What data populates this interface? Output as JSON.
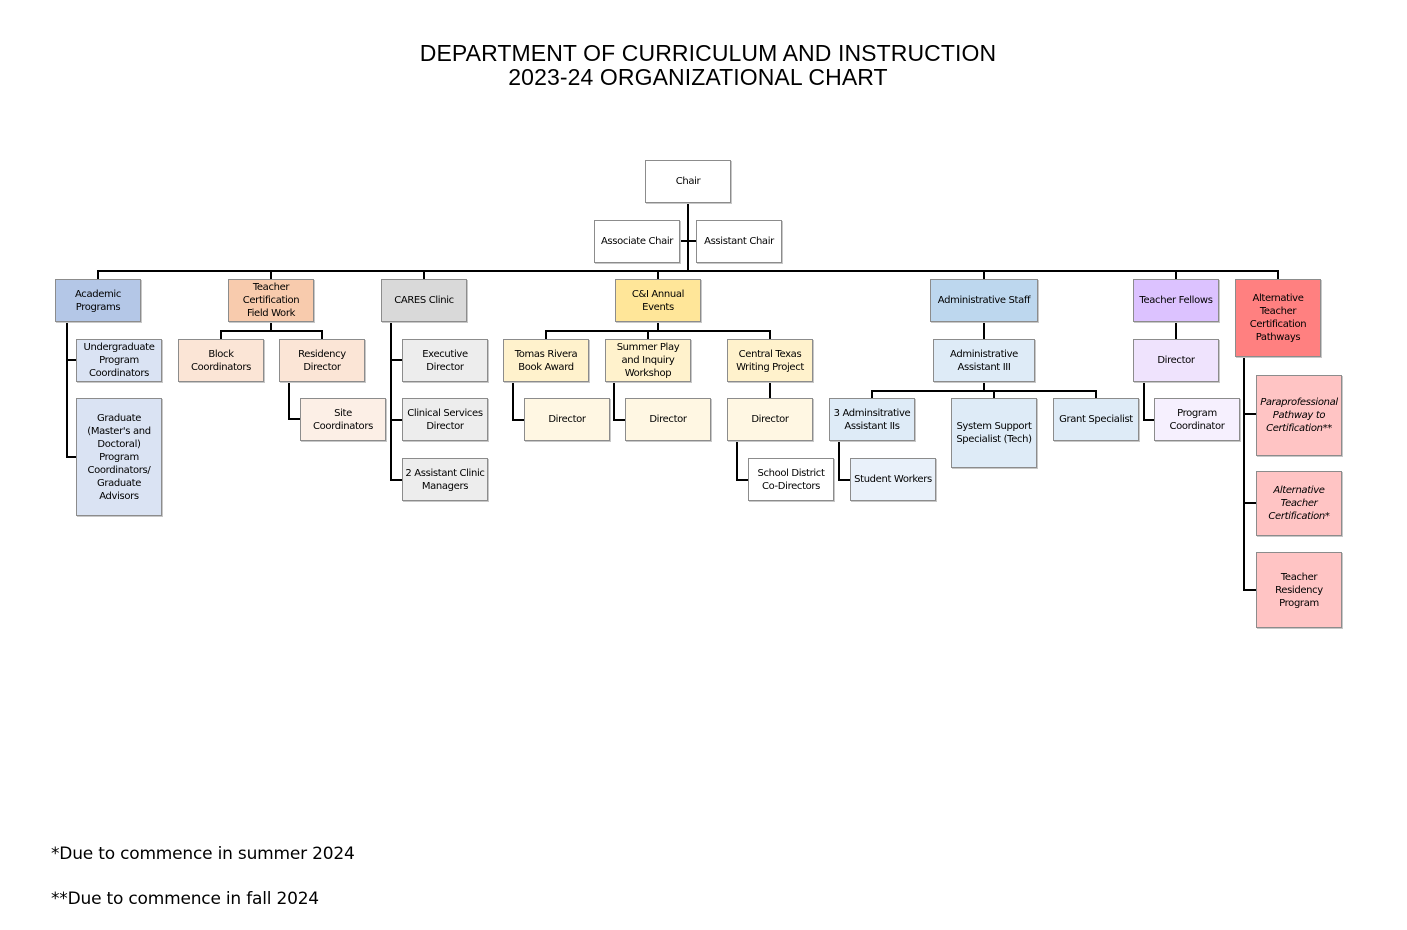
{
  "title": {
    "line1": "DEPARTMENT OF CURRICULUM AND INSTRUCTION",
    "line2": "2023-24 ORGANIZATIONAL CHART"
  },
  "colors": {
    "line": "#000000",
    "white": "#ffffff",
    "academic_dark": "#b4c7e7",
    "academic_light": "#dae3f3",
    "fieldwork_dark": "#f8cbad",
    "fieldwork_light": "#fbe5d6",
    "fieldwork_lighter": "#fcefe6",
    "cares_dark": "#d9d9d9",
    "cares_light": "#ededed",
    "events_dark": "#ffe699",
    "events_light": "#fff2cc",
    "events_lighter": "#fff7e3",
    "admin_dark": "#bdd7ee",
    "admin_light": "#deebf7",
    "admin_lighter": "#e9f1fa",
    "fellows_dark": "#dcc2ff",
    "fellows_light": "#efe3fd",
    "fellows_lighter": "#f6f0fe",
    "alt_dark": "#ff8080",
    "alt_light": "#ffc4c4"
  },
  "nodes": {
    "chair": "Chair",
    "associate_chair": "Associate Chair",
    "assistant_chair": "Assistant Chair",
    "academic_programs": "Academic\nPrograms",
    "undergrad_coordinators": "Undergraduate\nProgram\nCoordinators",
    "graduate_coordinators": "Graduate\n(Master's and\nDoctoral)\nProgram\nCoordinators/\nGraduate\nAdvisors",
    "teacher_cert_field_work": "Teacher\nCertification\nField Work",
    "block_coordinators": "Block\nCoordinators",
    "residency_director": "Residency\nDirector",
    "site_coordinators": "Site\nCoordinators",
    "cares_clinic": "CARES Clinic",
    "executive_director": "Executive\nDirector",
    "clinical_services_director": "Clinical Services\nDirector",
    "assistant_clinic_managers": "2 Assistant Clinic\nManagers",
    "annual_events": "C&I Annual\nEvents",
    "tomas_rivera": "Tomas Rivera\nBook Award",
    "tomas_rivera_director": "Director",
    "summer_play": "Summer Play\nand Inquiry\nWorkshop",
    "summer_play_director": "Director",
    "central_texas": "Central Texas\nWriting Project",
    "central_texas_director": "Director",
    "school_district_codirectors": "School District\nCo-Directors",
    "administrative_staff": "Administrative Staff",
    "admin_assistant_iii": "Administrative\nAssistant III",
    "admin_assistant_iis": "3 Adminsitrative\nAssistant IIs",
    "student_workers": "Student Workers",
    "system_support": "System Support\nSpecialist (Tech)",
    "grant_specialist": "Grant Specialist",
    "teacher_fellows": "Teacher Fellows",
    "fellows_director": "Director",
    "program_coordinator": "Program\nCoordinator",
    "alt_pathways": "Alternative\nTeacher\nCertification\nPathways",
    "paraprofessional_pathway": "Paraprofessional\nPathway to\nCertification**",
    "alt_teacher_cert": "Alternative\nTeacher\nCertification*",
    "teacher_residency_program": "Teacher\nResidency\nProgram"
  },
  "footnotes": {
    "note1": "*Due to commence in summer 2024",
    "note2": "**Due to commence in fall 2024"
  }
}
